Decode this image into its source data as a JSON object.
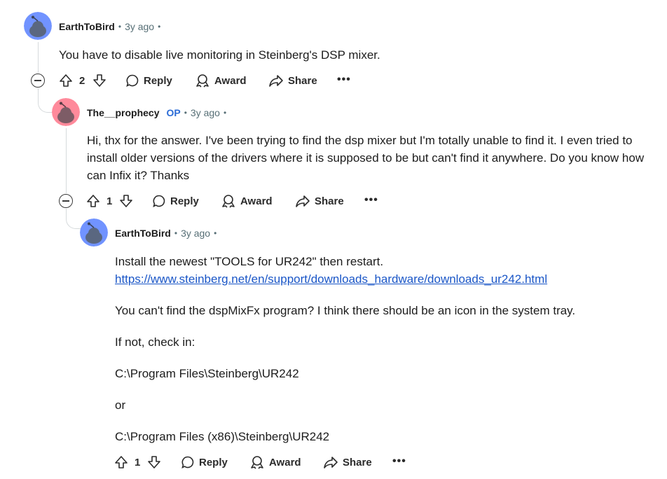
{
  "colors": {
    "avatar_blue": "#7193ff",
    "avatar_pink": "#ff8a9b",
    "op_badge": "#2a6bd6",
    "link": "#1a56c7"
  },
  "comments": [
    {
      "user": "EarthToBird",
      "time": "3y ago",
      "paragraphs": [
        "You have to disable live monitoring in Steinberg's DSP mixer."
      ],
      "votes": "2",
      "actions": {
        "reply": "Reply",
        "award": "Award",
        "share": "Share",
        "more": "•••"
      }
    },
    {
      "user": "The__prophecy",
      "op_badge": "OP",
      "time": "3y ago",
      "paragraphs": [
        "Hi, thx for the answer. I've been trying to find the dsp mixer but I'm totally unable to find it. I even tried to",
        "install older versions of the drivers where it is supposed to be but can't find it anywhere. Do you know how",
        "can Infix it? Thanks"
      ],
      "votes": "1",
      "actions": {
        "reply": "Reply",
        "award": "Award",
        "share": "Share",
        "more": "•••"
      }
    },
    {
      "user": "EarthToBird",
      "time": "3y ago",
      "line1": "Install the newest \"TOOLS for UR242\" then restart.",
      "link": "https://www.steinberg.net/en/support/downloads_hardware/downloads_ur242.html",
      "para2": "You can't find the dspMixFx program? I think there should be an icon in the system tray.",
      "para3": "If not, check in:",
      "para4": "C:\\Program Files\\Steinberg\\UR242",
      "para5": "or",
      "para6": "C:\\Program Files (x86)\\Steinberg\\UR242",
      "votes": "1",
      "actions": {
        "reply": "Reply",
        "award": "Award",
        "share": "Share",
        "more": "•••"
      }
    }
  ]
}
